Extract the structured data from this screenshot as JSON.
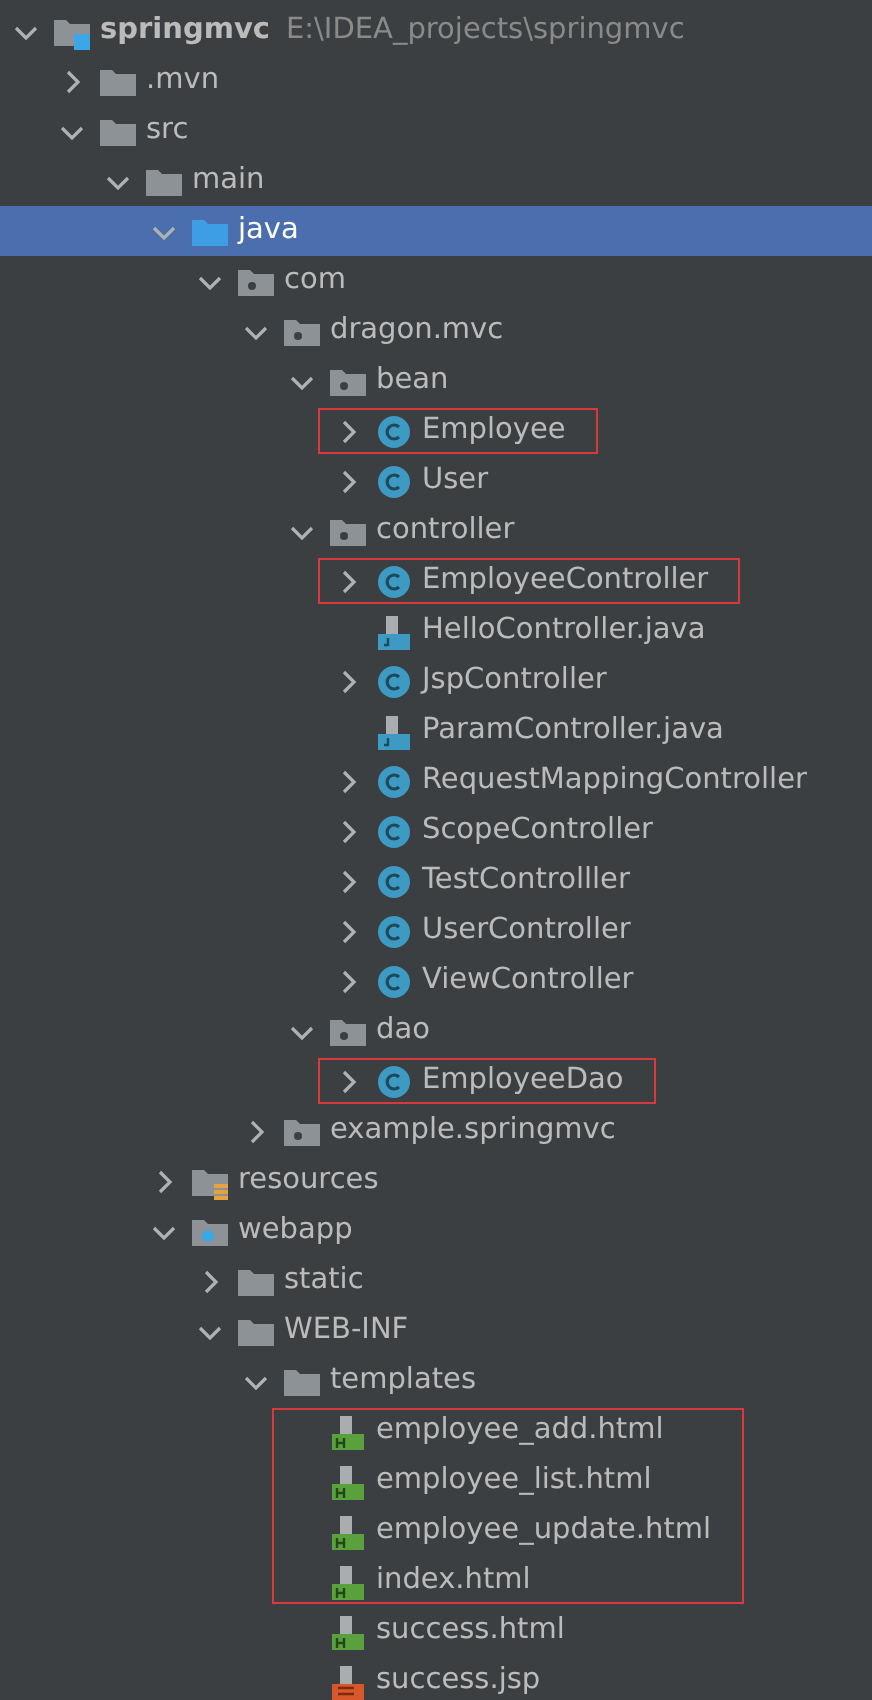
{
  "tree": [
    {
      "kind": "project",
      "label": "springmvc",
      "path": "E:\\IDEA_projects\\springmvc",
      "expanded": true,
      "selected": false,
      "children": [
        {
          "kind": "folder",
          "label": ".mvn",
          "expanded": false,
          "selected": false
        },
        {
          "kind": "folder",
          "label": "src",
          "expanded": true,
          "selected": false,
          "children": [
            {
              "kind": "folder",
              "label": "main",
              "expanded": true,
              "selected": false,
              "children": [
                {
                  "kind": "source-root",
                  "label": "java",
                  "expanded": true,
                  "selected": true,
                  "children": [
                    {
                      "kind": "package",
                      "label": "com",
                      "expanded": true,
                      "selected": false,
                      "children": [
                        {
                          "kind": "package",
                          "label": "dragon.mvc",
                          "expanded": true,
                          "selected": false,
                          "children": [
                            {
                              "kind": "package",
                              "label": "bean",
                              "expanded": true,
                              "selected": false,
                              "children": [
                                {
                                  "kind": "class",
                                  "label": "Employee",
                                  "expanded": false,
                                  "selected": false,
                                  "outlined": true
                                },
                                {
                                  "kind": "class",
                                  "label": "User",
                                  "expanded": false,
                                  "selected": false
                                }
                              ]
                            },
                            {
                              "kind": "package",
                              "label": "controller",
                              "expanded": true,
                              "selected": false,
                              "children": [
                                {
                                  "kind": "class",
                                  "label": "EmployeeController",
                                  "expanded": false,
                                  "selected": false,
                                  "outlined": true
                                },
                                {
                                  "kind": "java-file",
                                  "label": "HelloController.java",
                                  "selected": false
                                },
                                {
                                  "kind": "class",
                                  "label": "JspController",
                                  "expanded": false,
                                  "selected": false
                                },
                                {
                                  "kind": "java-file",
                                  "label": "ParamController.java",
                                  "selected": false
                                },
                                {
                                  "kind": "class",
                                  "label": "RequestMappingController",
                                  "expanded": false,
                                  "selected": false
                                },
                                {
                                  "kind": "class",
                                  "label": "ScopeController",
                                  "expanded": false,
                                  "selected": false
                                },
                                {
                                  "kind": "class",
                                  "label": "TestControlller",
                                  "expanded": false,
                                  "selected": false
                                },
                                {
                                  "kind": "class",
                                  "label": "UserController",
                                  "expanded": false,
                                  "selected": false
                                },
                                {
                                  "kind": "class",
                                  "label": "ViewController",
                                  "expanded": false,
                                  "selected": false
                                }
                              ]
                            },
                            {
                              "kind": "package",
                              "label": "dao",
                              "expanded": true,
                              "selected": false,
                              "children": [
                                {
                                  "kind": "class",
                                  "label": "EmployeeDao",
                                  "expanded": false,
                                  "selected": false,
                                  "outlined": true
                                }
                              ]
                            }
                          ]
                        },
                        {
                          "kind": "package",
                          "label": "example.springmvc",
                          "expanded": false,
                          "selected": false
                        }
                      ]
                    }
                  ]
                },
                {
                  "kind": "resources-root",
                  "label": "resources",
                  "expanded": false,
                  "selected": false
                },
                {
                  "kind": "web-root",
                  "label": "webapp",
                  "expanded": true,
                  "selected": false,
                  "children": [
                    {
                      "kind": "folder",
                      "label": "static",
                      "expanded": false,
                      "selected": false
                    },
                    {
                      "kind": "folder",
                      "label": "WEB-INF",
                      "expanded": true,
                      "selected": false,
                      "children": [
                        {
                          "kind": "folder",
                          "label": "templates",
                          "expanded": true,
                          "selected": false,
                          "children": [
                            {
                              "kind": "html-file",
                              "label": "employee_add.html",
                              "selected": false,
                              "outlined": true
                            },
                            {
                              "kind": "html-file",
                              "label": "employee_list.html",
                              "selected": false,
                              "outlined": true
                            },
                            {
                              "kind": "html-file",
                              "label": "employee_update.html",
                              "selected": false,
                              "outlined": true
                            },
                            {
                              "kind": "html-file",
                              "label": "index.html",
                              "selected": false,
                              "outlined": true
                            },
                            {
                              "kind": "html-file",
                              "label": "success.html",
                              "selected": false
                            },
                            {
                              "kind": "jsp-file",
                              "label": "success.jsp",
                              "selected": false
                            }
                          ]
                        }
                      ]
                    }
                  ]
                }
              ]
            }
          ]
        }
      ]
    }
  ]
}
